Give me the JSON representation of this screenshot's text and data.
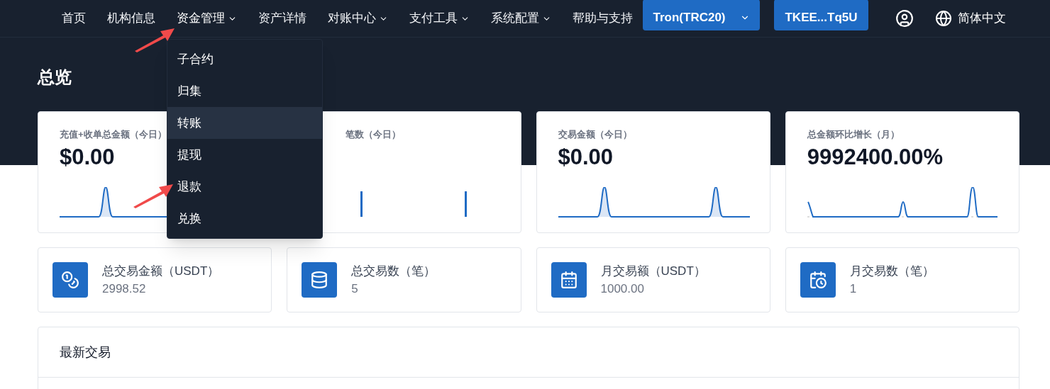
{
  "nav": {
    "items": [
      {
        "label": "首页",
        "has_menu": false,
        "expanded": false
      },
      {
        "label": "机构信息",
        "has_menu": false,
        "expanded": false
      },
      {
        "label": "资金管理",
        "has_menu": true,
        "expanded": true
      },
      {
        "label": "资产详情",
        "has_menu": false,
        "expanded": false
      },
      {
        "label": "对账中心",
        "has_menu": true,
        "expanded": false
      },
      {
        "label": "支付工具",
        "has_menu": true,
        "expanded": false
      },
      {
        "label": "系统配置",
        "has_menu": true,
        "expanded": false
      },
      {
        "label": "帮助与支持",
        "has_menu": false,
        "expanded": false
      }
    ],
    "network": "Tron(TRC20)",
    "address": "TKEE...Tq5U",
    "language": "简体中文"
  },
  "menu": {
    "items": [
      {
        "label": "子合约",
        "highlighted": false
      },
      {
        "label": "归集",
        "highlighted": false
      },
      {
        "label": "转账",
        "highlighted": true
      },
      {
        "label": "提现",
        "highlighted": false
      },
      {
        "label": "退款",
        "highlighted": false
      },
      {
        "label": "兑换",
        "highlighted": false
      }
    ]
  },
  "title": "总览",
  "metric_cards": [
    {
      "label": "充值+收单总金额（今日）",
      "value": "$0.00",
      "kind": "area"
    },
    {
      "label": "笔数（今日）",
      "kind": "bars"
    },
    {
      "label": "交易金额（今日）",
      "value": "$0.00",
      "kind": "area"
    },
    {
      "label": "总金额环比增长（月）",
      "value": "9992400.00%",
      "kind": "line"
    }
  ],
  "stat_cards": [
    {
      "label": "总交易金额（USDT）",
      "value": "2998.52"
    },
    {
      "label": "总交易数（笔）",
      "value": "5"
    },
    {
      "label": "月交易额（USDT）",
      "value": "1000.00"
    },
    {
      "label": "月交易数（笔）",
      "value": "1"
    }
  ],
  "recent": {
    "title": "最新交易"
  }
}
